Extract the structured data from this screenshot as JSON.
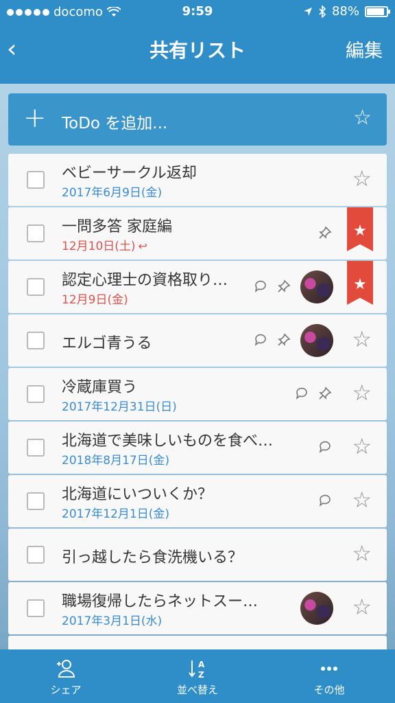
{
  "status_bar": {
    "carrier": "docomo",
    "time": "9:59",
    "battery": "88%",
    "battery_level": 0.88
  },
  "nav": {
    "back_label": "‹",
    "title": "共有リスト",
    "edit_label": "編集"
  },
  "add_bar": {
    "plus": "+",
    "placeholder": "ToDo を追加...",
    "star": "☆"
  },
  "items": [
    {
      "title": "ベビーサークル返却",
      "date": "2017年6月9日(金)",
      "date_color": "blue",
      "comment": false,
      "pin": false,
      "avatar": false,
      "starred": false
    },
    {
      "title": "一問多答 家庭編",
      "date": "12月10日(土)",
      "date_color": "red",
      "repeat": "↩",
      "comment": false,
      "pin": true,
      "avatar": false,
      "starred": true
    },
    {
      "title": "認定心理士の資格取り…",
      "date": "12月9日(金)",
      "date_color": "red",
      "comment": true,
      "pin": true,
      "avatar": true,
      "starred": true
    },
    {
      "title": "エルゴ青うる",
      "date": "",
      "comment": true,
      "pin": true,
      "avatar": true,
      "starred": false
    },
    {
      "title": "冷蔵庫買う",
      "date": "2017年12月31日(日)",
      "date_color": "blue",
      "comment": true,
      "pin": true,
      "avatar": false,
      "starred": false
    },
    {
      "title": "北海道で美味しいものを食べ…",
      "date": "2018年8月17日(金)",
      "date_color": "blue",
      "comment": true,
      "pin": false,
      "avatar": false,
      "starred": false
    },
    {
      "title": "北海道にいついくか？",
      "date": "2017年12月1日(金)",
      "date_color": "blue",
      "comment": true,
      "pin": false,
      "avatar": false,
      "starred": false
    },
    {
      "title": "引っ越したら食洗機いる？",
      "date": "",
      "comment": false,
      "pin": false,
      "avatar": false,
      "starred": false
    },
    {
      "title": "職場復帰したらネットスー…",
      "date": "2017年3月1日(水)",
      "date_color": "blue",
      "comment": false,
      "pin": false,
      "avatar": true,
      "starred": false
    }
  ],
  "tabs": [
    {
      "label": "シェア",
      "icon": "share-person-icon"
    },
    {
      "label": "並べ替え",
      "icon": "sort-az-icon"
    },
    {
      "label": "その他",
      "icon": "more-dots-icon"
    }
  ],
  "colors": {
    "accent": "#2f8ec7",
    "date_blue": "#3a8bd0",
    "date_red": "#d9534f",
    "ribbon": "#e24a3c"
  }
}
